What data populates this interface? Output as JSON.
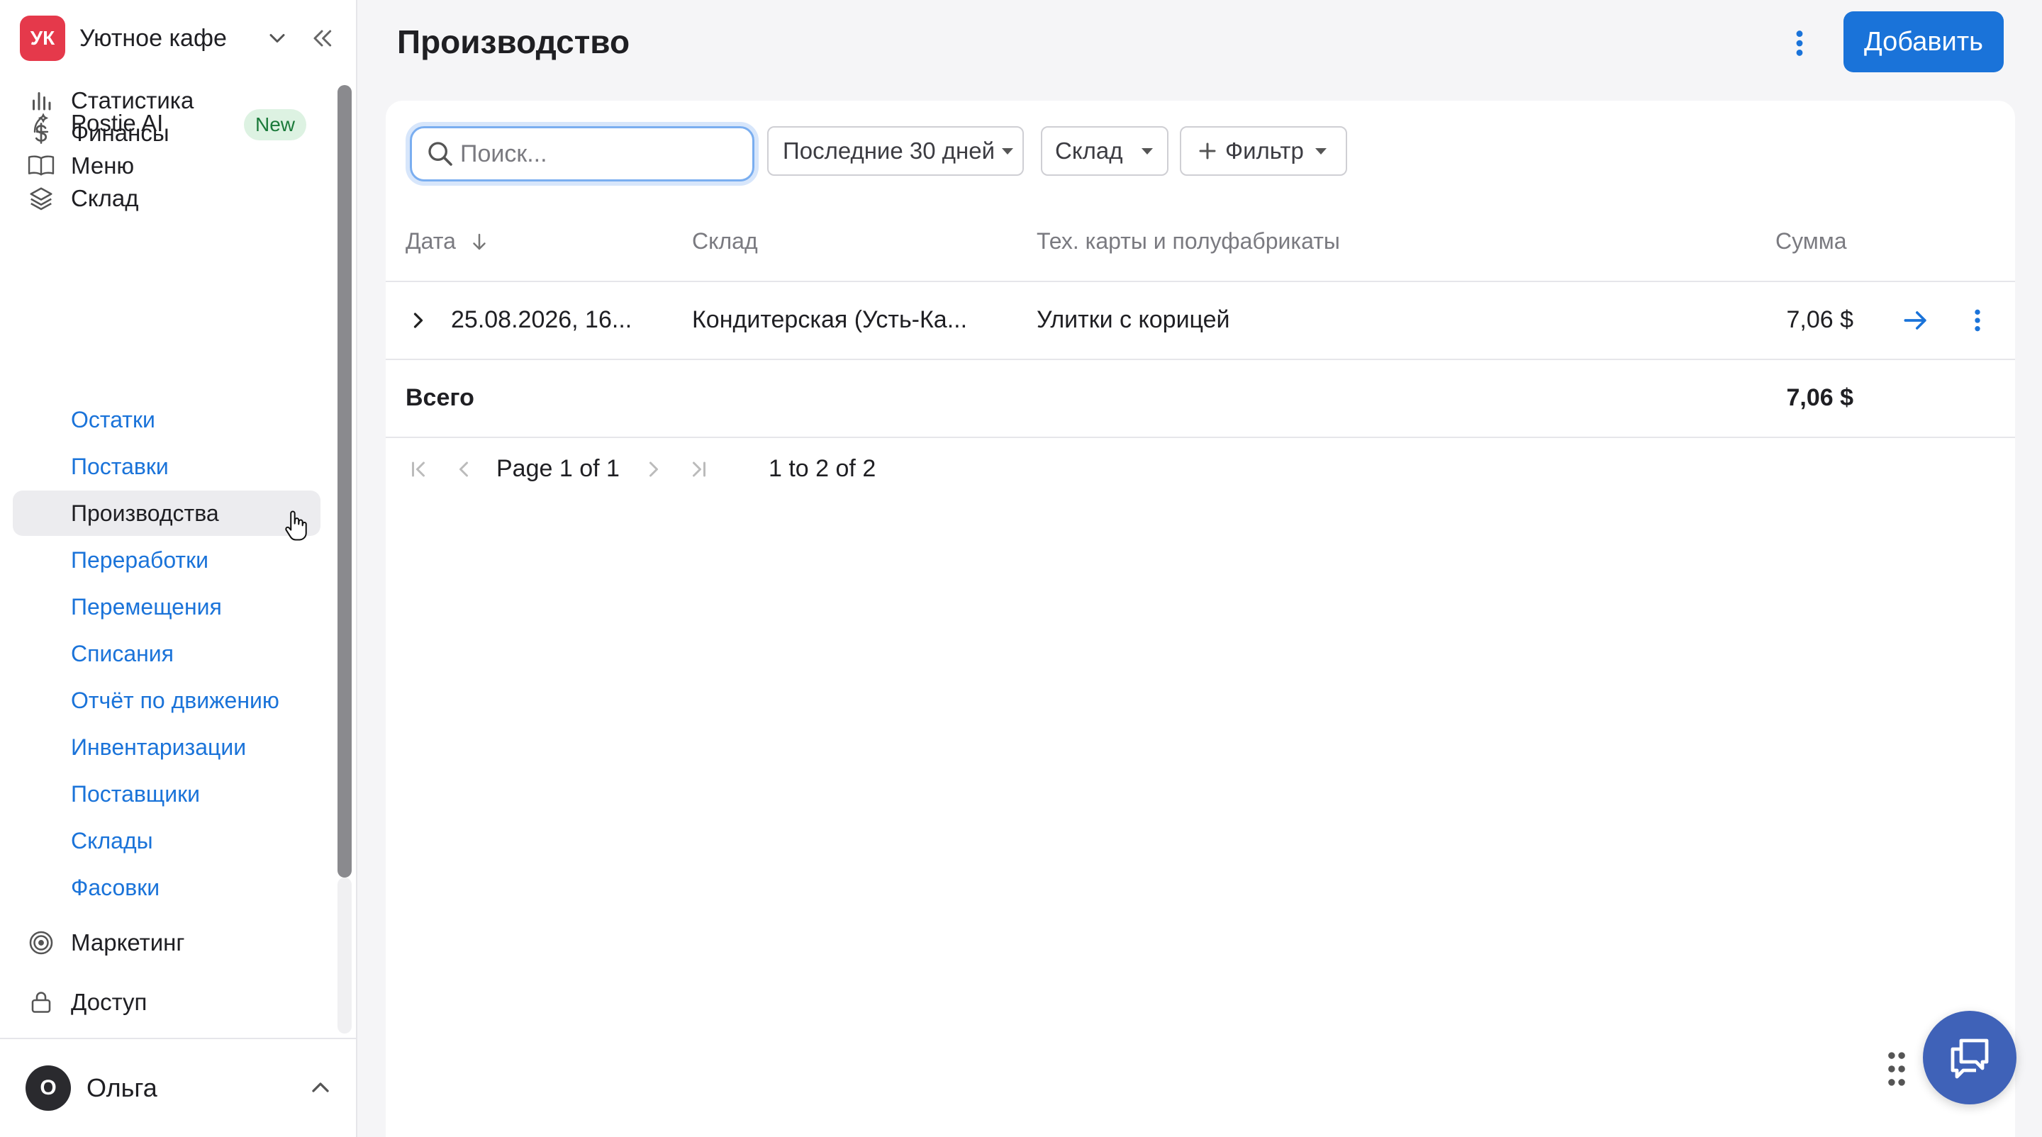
{
  "workspace": {
    "initials": "УК",
    "name": "Уютное кафе",
    "avatar_color": "#e5394b"
  },
  "nav": {
    "postie": {
      "label": "Postie AI",
      "badge": "New"
    },
    "stats": {
      "label": "Статистика"
    },
    "finance": {
      "label": "Финансы"
    },
    "menu": {
      "label": "Меню"
    },
    "warehouse": {
      "label": "Склад"
    },
    "marketing": {
      "label": "Маркетинг"
    },
    "access": {
      "label": "Доступ"
    },
    "sub": [
      "Остатки",
      "Поставки",
      "Производства",
      "Переработки",
      "Перемещения",
      "Списания",
      "Отчёт по движению",
      "Инвентаризации",
      "Поставщики",
      "Склады",
      "Фасовки"
    ],
    "active_sub": "Производства"
  },
  "user": {
    "initial": "О",
    "name": "Ольга"
  },
  "header": {
    "title": "Производство",
    "add_label": "Добавить"
  },
  "filters": {
    "search_placeholder": "Поиск...",
    "period": "Последние 30 дней",
    "warehouse": "Склад",
    "filter": "Фильтр"
  },
  "table": {
    "columns": {
      "date": "Дата",
      "warehouse": "Склад",
      "cards": "Тех. карты и полуфабрикаты",
      "sum": "Сумма"
    },
    "rows": [
      {
        "date": "25.08.2026, 16...",
        "warehouse": "Кондитерская (Усть-Ка...",
        "cards": "Улитки с корицей",
        "sum": "7,06 $"
      }
    ],
    "total_label": "Всего",
    "total_value": "7,06 $"
  },
  "pager": {
    "page_text": "Page 1 of 1",
    "range_text": "1 to 2 of 2"
  },
  "colors": {
    "accent": "#1a73d9",
    "link": "#1a73d9",
    "badge_bg": "#ddf2e2",
    "chat": "#3f62b8"
  }
}
